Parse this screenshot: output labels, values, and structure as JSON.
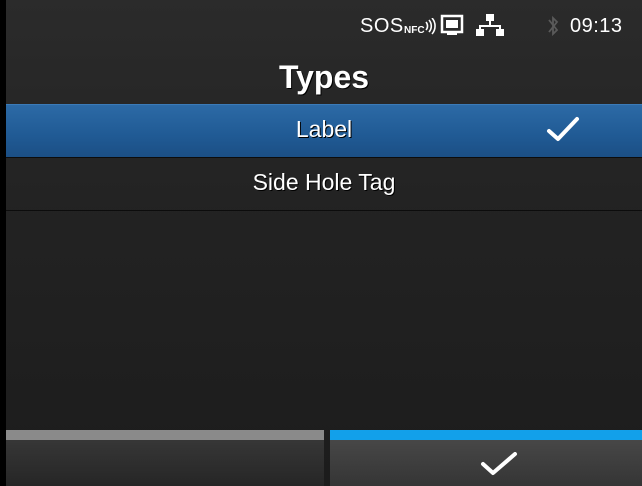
{
  "status": {
    "sos": "SOS",
    "nfc": "NFC",
    "time": "09:13"
  },
  "title": "Types",
  "options": [
    {
      "label": "Label",
      "selected": true
    },
    {
      "label": "Side Hole Tag",
      "selected": false
    }
  ],
  "footer": {
    "left_button_label": "",
    "confirm_icon": "checkmark-icon"
  },
  "colors": {
    "selected_row": "#2166a3",
    "confirm_accent": "#12a0ea",
    "left_accent": "#8a8a8a"
  }
}
